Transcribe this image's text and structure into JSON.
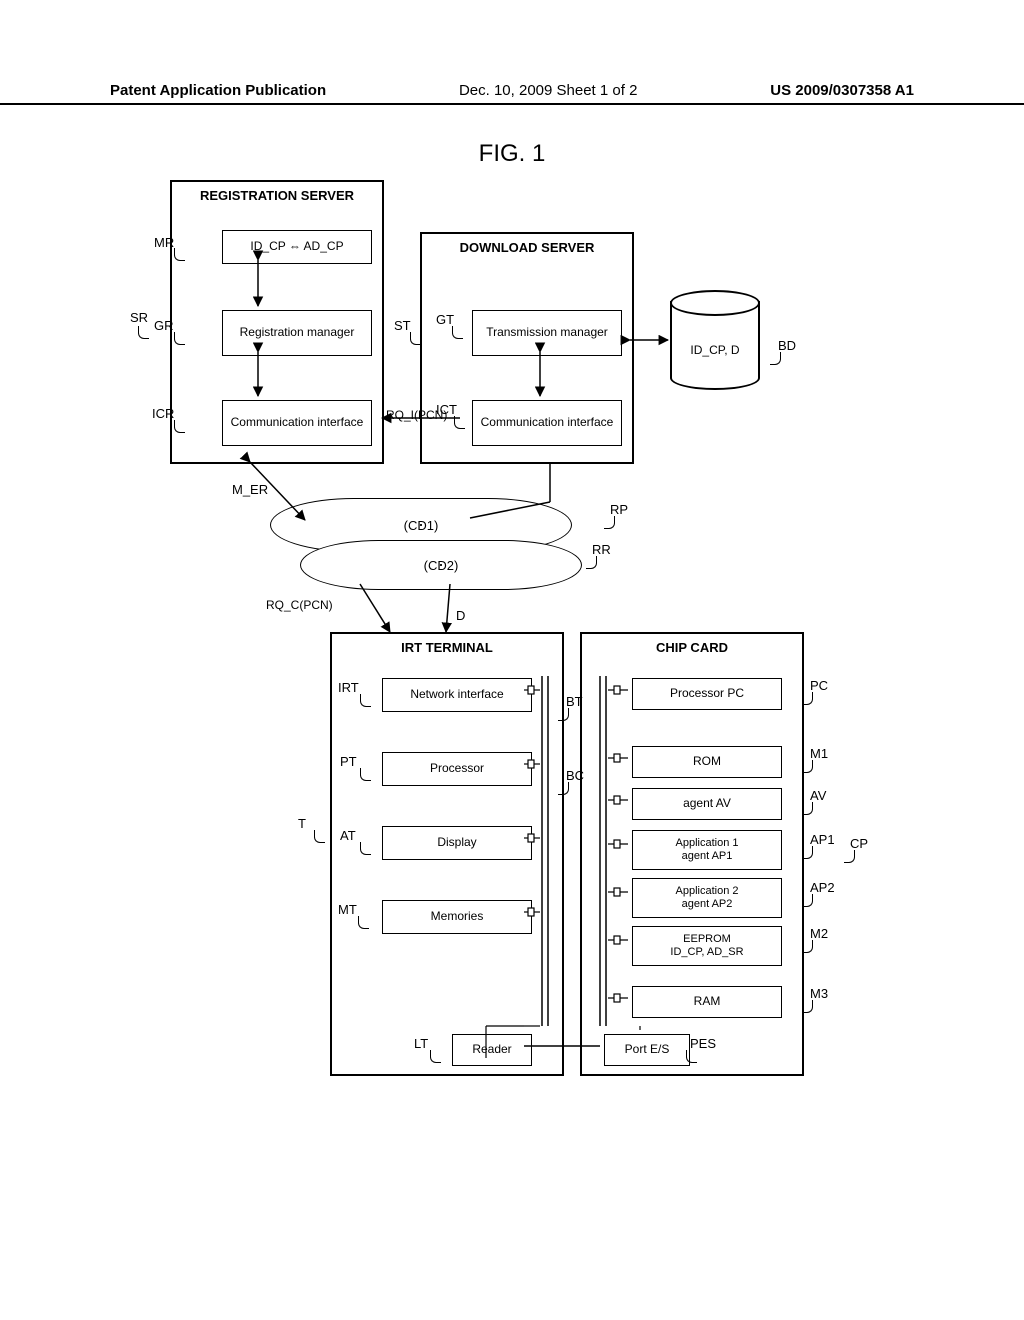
{
  "header": {
    "left": "Patent Application Publication",
    "center": "Dec. 10, 2009  Sheet 1 of 2",
    "right": "US 2009/0307358 A1"
  },
  "fig_title": "FIG. 1",
  "registration_server": {
    "title": "REGISTRATION SERVER",
    "mr_box": "ID_CP ⇔ AD_CP",
    "gr_box": "Registration manager",
    "icr_box": "Communication interface"
  },
  "download_server": {
    "title": "DOWNLOAD SERVER",
    "gt_box": "Transmission manager",
    "ict_box": "Communication interface"
  },
  "db": {
    "content": "ID_CP, D"
  },
  "rq_i": "RQ_I(PCN)",
  "cloud1": "(CD1)",
  "cloud2": "(CD2)",
  "rq_c": "RQ_C(PCN)",
  "d_label": "D",
  "m_er": "M_ER",
  "rp": "RP",
  "rr": "RR",
  "labels": {
    "SR": "SR",
    "MR": "MR",
    "GR": "GR",
    "ICR": "ICR",
    "ST": "ST",
    "GT": "GT",
    "ICT": "ICT",
    "BD": "BD",
    "T": "T",
    "IRT": "IRT",
    "PT": "PT",
    "AT": "AT",
    "MT": "MT",
    "LT": "LT",
    "BT": "BT",
    "BC": "BC",
    "PC": "PC",
    "M1": "M1",
    "AV": "AV",
    "AP1": "AP1",
    "AP2": "AP2",
    "CP": "CP",
    "M2": "M2",
    "M3": "M3",
    "PES": "PES"
  },
  "irt_terminal": {
    "title": "IRT TERMINAL",
    "irt": "Network interface",
    "pt": "Processor",
    "at": "Display",
    "mt": "Memories",
    "lt": "Reader"
  },
  "chip_card": {
    "title": "CHIP CARD",
    "pc": "Processor PC",
    "rom": "ROM",
    "av": "agent AV",
    "ap1_line1": "Application 1",
    "ap1_line2": "agent AP1",
    "ap2_line1": "Application 2",
    "ap2_line2": "agent AP2",
    "m2_line1": "EEPROM",
    "m2_line2": "ID_CP, AD_SR",
    "ram": "RAM",
    "pes": "Port E/S"
  }
}
